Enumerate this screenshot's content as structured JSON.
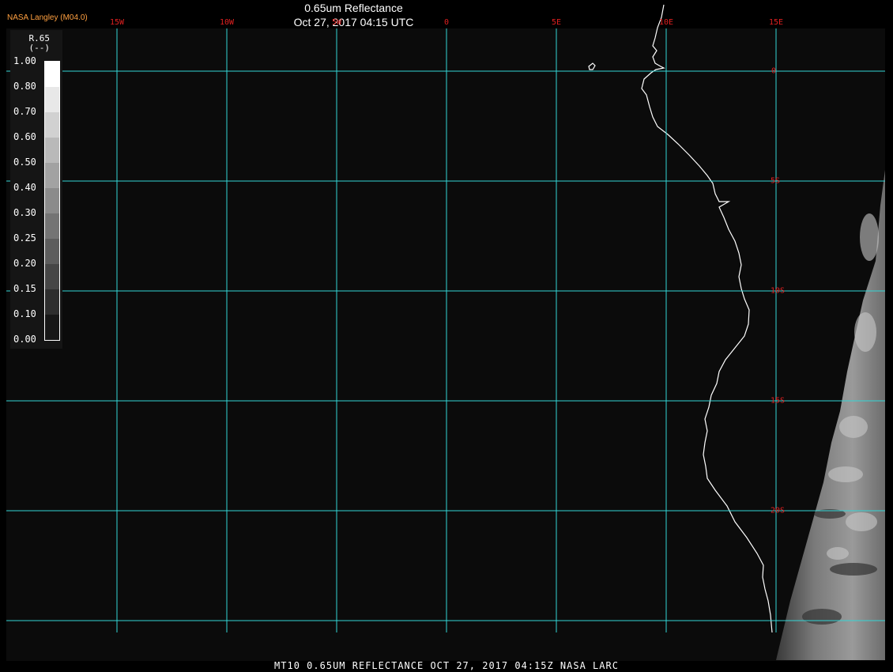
{
  "header": {
    "title": "0.65um Reflectance",
    "subtitle": "Oct 27, 2017 04:15 UTC",
    "credit": "NASA Langley (M04.0)"
  },
  "grid": {
    "color": "#33d6d6",
    "label_color": "#e02020",
    "longitudes": [
      {
        "label": "15W",
        "deg": -15
      },
      {
        "label": "10W",
        "deg": -10
      },
      {
        "label": "5W",
        "deg": -5
      },
      {
        "label": "0",
        "deg": 0
      },
      {
        "label": "5E",
        "deg": 5
      },
      {
        "label": "10E",
        "deg": 10
      },
      {
        "label": "15E",
        "deg": 15
      }
    ],
    "latitudes": [
      {
        "label": "0",
        "deg": 0
      },
      {
        "label": "5S",
        "deg": -5
      },
      {
        "label": "10S",
        "deg": -10
      },
      {
        "label": "15S",
        "deg": -15
      },
      {
        "label": "20S",
        "deg": -20
      }
    ]
  },
  "legend": {
    "variable": "R.65",
    "units": "(--)",
    "ticks": [
      "1.00",
      "0.80",
      "0.70",
      "0.60",
      "0.50",
      "0.40",
      "0.30",
      "0.25",
      "0.20",
      "0.15",
      "0.10",
      "0.00"
    ]
  },
  "footer": {
    "text": "MT10  0.65UM REFLECTANCE   OCT 27, 2017 04:15Z   NASA LARC"
  },
  "colors": {
    "background": "#0b0b0b",
    "coastline": "#ffffff",
    "credit": "#ffa040"
  }
}
